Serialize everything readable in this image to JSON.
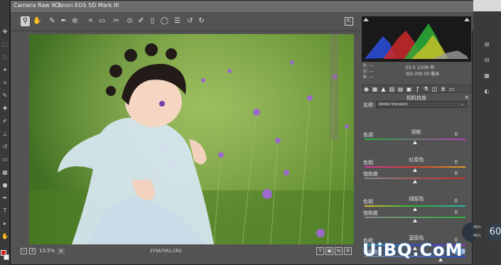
{
  "window": {
    "app_title": "Camera Raw 9.7",
    "camera_model": "Canon EOS 5D Mark III"
  },
  "toolbar": {
    "tools": [
      "zoom-icon",
      "hand-icon",
      "white-balance-icon",
      "color-sampler-icon",
      "targeted-adjust-icon",
      "crop-icon",
      "straighten-icon",
      "spot-removal-icon",
      "red-eye-icon",
      "adjustment-brush-icon",
      "graduated-filter-icon",
      "radial-filter-icon",
      "preferences-icon",
      "rotate-ccw-icon",
      "rotate-cw-icon"
    ]
  },
  "bottom_bar": {
    "zoom_minus": "−",
    "zoom_plus": "+",
    "zoom_level": "13.5%",
    "zoom_dropdown": "▾",
    "filename": "2Y5A7051.CR2",
    "view_buttons": [
      "Y",
      "▣",
      "⇆",
      "⚙"
    ]
  },
  "histogram": {
    "rgb_readout": [
      "R:  ---",
      "G:  ---",
      "B:  ---"
    ],
    "aperture_shutter": "f/2.5   1/200 秒",
    "iso_focal": "ISO 200   50 毫米"
  },
  "panel": {
    "title": "相机校准",
    "menu_icon": "≡",
    "name_label": "名称:",
    "name_value": "Adobe Standard",
    "name_arrow": "⌄",
    "sections": [
      {
        "heading": "阴影",
        "sliders": [
          {
            "label": "色调",
            "value": "0",
            "position": 0.5,
            "gradient": "linear-gradient(90deg,#21b03a,#b93fb6)"
          }
        ]
      },
      {
        "heading": "红原色",
        "sliders": [
          {
            "label": "色相",
            "value": "0",
            "position": 0.5,
            "gradient": "linear-gradient(90deg,#d53a9b,#d83a2a,#d8a12a)"
          },
          {
            "label": "饱和度",
            "value": "0",
            "position": 0.5,
            "gradient": "linear-gradient(90deg,#8a8a8a,#cc2a2a)"
          }
        ]
      },
      {
        "heading": "绿原色",
        "sliders": [
          {
            "label": "色相",
            "value": "0",
            "position": 0.5,
            "gradient": "linear-gradient(90deg,#d2c12a,#2ab13a,#2ab3a6)"
          },
          {
            "label": "饱和度",
            "value": "0",
            "position": 0.5,
            "gradient": "linear-gradient(90deg,#8a8a8a,#2ab13a)"
          }
        ]
      },
      {
        "heading": "蓝原色",
        "sliders": [
          {
            "label": "色相",
            "value": "0",
            "position": 0.5,
            "gradient": "linear-gradient(90deg,#2ab3c6,#2a4bd3,#9d2ad3)"
          },
          {
            "label": "饱和度",
            "value": "+50",
            "position": 0.75,
            "gradient": "linear-gradient(90deg,#8a8a8a,#2a4bd3)"
          }
        ]
      }
    ]
  },
  "overlay": {
    "line1": "0K/s",
    "line2": "0K/s",
    "percent": "60"
  },
  "watermark": "UiBQ.CoM",
  "colors": {
    "dialog_bg": "#535353",
    "accent_highlight": "#7aa3d8",
    "foreground_swatch": "#d21b1b"
  }
}
